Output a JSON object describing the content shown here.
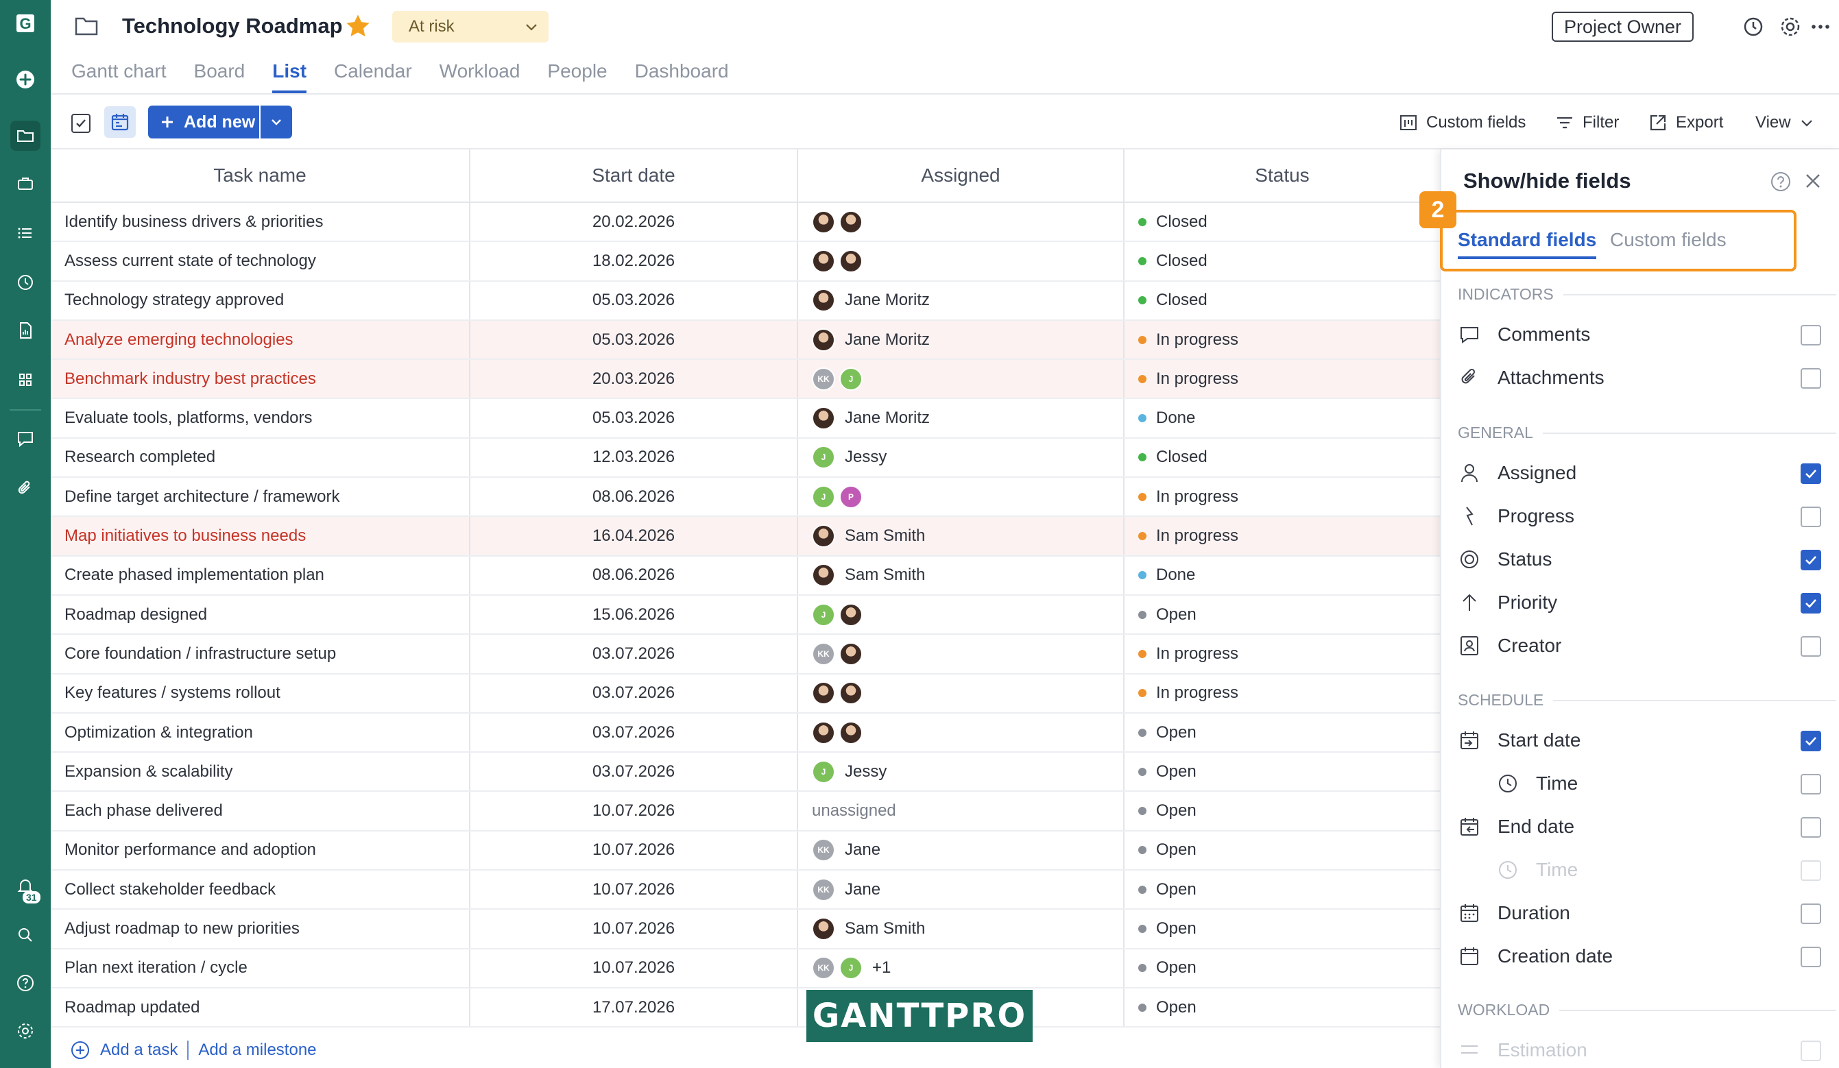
{
  "app": {
    "logo": "G",
    "badge_count": "31"
  },
  "header": {
    "title": "Technology Roadmap",
    "status": "At risk",
    "role_button": "Project Owner",
    "tabs": [
      "Gantt chart",
      "Board",
      "List",
      "Calendar",
      "Workload",
      "People",
      "Dashboard"
    ],
    "active_tab": "List"
  },
  "toolbar": {
    "add_new": "Add new",
    "custom_fields": "Custom fields",
    "filter": "Filter",
    "export": "Export",
    "view": "View"
  },
  "table": {
    "columns": [
      "Task name",
      "Start date",
      "Assigned",
      "Status"
    ],
    "rows": [
      {
        "name": "Identify business drivers & priorities",
        "date": "20.02.2026",
        "assigned": [
          {
            "type": "photo"
          },
          {
            "type": "photo"
          }
        ],
        "assigned_text": "",
        "status": "Closed",
        "dot": "#43b54a",
        "red": false
      },
      {
        "name": "Assess current state of technology",
        "date": "18.02.2026",
        "assigned": [
          {
            "type": "photo"
          },
          {
            "type": "photo"
          }
        ],
        "assigned_text": "",
        "status": "Closed",
        "dot": "#43b54a",
        "red": false
      },
      {
        "name": "Technology strategy approved",
        "date": "05.03.2026",
        "assigned": [
          {
            "type": "photo"
          }
        ],
        "assigned_text": "Jane Moritz",
        "status": "Closed",
        "dot": "#43b54a",
        "red": false
      },
      {
        "name": "Analyze emerging technologies",
        "date": "05.03.2026",
        "assigned": [
          {
            "type": "photo"
          }
        ],
        "assigned_text": "Jane Moritz",
        "status": "In progress",
        "dot": "#f0922b",
        "red": true
      },
      {
        "name": "Benchmark industry best practices",
        "date": "20.03.2026",
        "assigned": [
          {
            "type": "kk",
            "label": "KK"
          },
          {
            "type": "j",
            "label": "J"
          }
        ],
        "assigned_text": "",
        "status": "In progress",
        "dot": "#f0922b",
        "red": true
      },
      {
        "name": "Evaluate tools, platforms, vendors",
        "date": "05.03.2026",
        "assigned": [
          {
            "type": "photo"
          }
        ],
        "assigned_text": "Jane Moritz",
        "status": "Done",
        "dot": "#5bb3e0",
        "red": false
      },
      {
        "name": "Research completed",
        "date": "12.03.2026",
        "assigned": [
          {
            "type": "j",
            "label": "J"
          }
        ],
        "assigned_text": "Jessy",
        "status": "Closed",
        "dot": "#43b54a",
        "red": false
      },
      {
        "name": "Define target architecture / framework",
        "date": "08.06.2026",
        "assigned": [
          {
            "type": "j",
            "label": "J"
          },
          {
            "type": "p",
            "label": "P"
          }
        ],
        "assigned_text": "",
        "status": "In progress",
        "dot": "#f0922b",
        "red": false
      },
      {
        "name": "Map initiatives to business needs",
        "date": "16.04.2026",
        "assigned": [
          {
            "type": "photo"
          }
        ],
        "assigned_text": "Sam Smith",
        "status": "In progress",
        "dot": "#f0922b",
        "red": true
      },
      {
        "name": "Create phased implementation plan",
        "date": "08.06.2026",
        "assigned": [
          {
            "type": "photo"
          }
        ],
        "assigned_text": "Sam Smith",
        "status": "Done",
        "dot": "#5bb3e0",
        "red": false
      },
      {
        "name": "Roadmap designed",
        "date": "15.06.2026",
        "assigned": [
          {
            "type": "j",
            "label": "J"
          },
          {
            "type": "photo"
          }
        ],
        "assigned_text": "",
        "status": "Open",
        "dot": "#8a8f97",
        "red": false
      },
      {
        "name": "Core foundation / infrastructure setup",
        "date": "03.07.2026",
        "assigned": [
          {
            "type": "kk",
            "label": "KK"
          },
          {
            "type": "photo"
          }
        ],
        "assigned_text": "",
        "status": "In progress",
        "dot": "#f0922b",
        "red": false
      },
      {
        "name": "Key features / systems rollout",
        "date": "03.07.2026",
        "assigned": [
          {
            "type": "photo"
          },
          {
            "type": "photo"
          }
        ],
        "assigned_text": "",
        "status": "In progress",
        "dot": "#f0922b",
        "red": false
      },
      {
        "name": "Optimization & integration",
        "date": "03.07.2026",
        "assigned": [
          {
            "type": "photo"
          },
          {
            "type": "photo"
          }
        ],
        "assigned_text": "",
        "status": "Open",
        "dot": "#8a8f97",
        "red": false
      },
      {
        "name": "Expansion & scalability",
        "date": "03.07.2026",
        "assigned": [
          {
            "type": "j",
            "label": "J"
          }
        ],
        "assigned_text": "Jessy",
        "status": "Open",
        "dot": "#8a8f97",
        "red": false
      },
      {
        "name": "Each phase delivered",
        "date": "10.07.2026",
        "assigned": [],
        "assigned_text": "unassigned",
        "status": "Open",
        "dot": "#8a8f97",
        "red": false
      },
      {
        "name": "Monitor performance and adoption",
        "date": "10.07.2026",
        "assigned": [
          {
            "type": "kk",
            "label": "KK"
          }
        ],
        "assigned_text": "Jane",
        "status": "Open",
        "dot": "#8a8f97",
        "red": false
      },
      {
        "name": "Collect stakeholder feedback",
        "date": "10.07.2026",
        "assigned": [
          {
            "type": "kk",
            "label": "KK"
          }
        ],
        "assigned_text": "Jane",
        "status": "Open",
        "dot": "#8a8f97",
        "red": false
      },
      {
        "name": "Adjust roadmap to new priorities",
        "date": "10.07.2026",
        "assigned": [
          {
            "type": "photo"
          }
        ],
        "assigned_text": "Sam Smith",
        "status": "Open",
        "dot": "#8a8f97",
        "red": false
      },
      {
        "name": "Plan next iteration / cycle",
        "date": "10.07.2026",
        "assigned": [
          {
            "type": "kk",
            "label": "KK"
          },
          {
            "type": "j",
            "label": "J"
          }
        ],
        "assigned_text": "+1",
        "status": "Open",
        "dot": "#8a8f97",
        "red": false
      },
      {
        "name": "Roadmap updated",
        "date": "17.07.2026",
        "assigned": [],
        "assigned_text": "",
        "status": "Open",
        "dot": "#8a8f97",
        "red": false
      }
    ],
    "add_task": "Add a task",
    "add_milestone": "Add a milestone"
  },
  "watermark": "GANTTPRO",
  "panel": {
    "title": "Show/hide fields",
    "step_number": "2",
    "tab_standard": "Standard fields",
    "tab_custom": "Custom fields",
    "sections": {
      "indicators": "INDICATORS",
      "general": "GENERAL",
      "schedule": "SCHEDULE",
      "workload": "WORKLOAD"
    },
    "fields": {
      "comments": {
        "label": "Comments",
        "checked": false
      },
      "attachments": {
        "label": "Attachments",
        "checked": false
      },
      "assigned": {
        "label": "Assigned",
        "checked": true
      },
      "progress": {
        "label": "Progress",
        "checked": false
      },
      "status": {
        "label": "Status",
        "checked": true
      },
      "priority": {
        "label": "Priority",
        "checked": true
      },
      "creator": {
        "label": "Creator",
        "checked": false
      },
      "start_date": {
        "label": "Start date",
        "checked": true
      },
      "start_time": {
        "label": "Time",
        "checked": false
      },
      "end_date": {
        "label": "End date",
        "checked": false
      },
      "end_time": {
        "label": "Time",
        "checked": false,
        "disabled": true
      },
      "duration": {
        "label": "Duration",
        "checked": false
      },
      "creation_date": {
        "label": "Creation date",
        "checked": false
      },
      "estimation": {
        "label": "Estimation",
        "checked": false
      }
    }
  }
}
